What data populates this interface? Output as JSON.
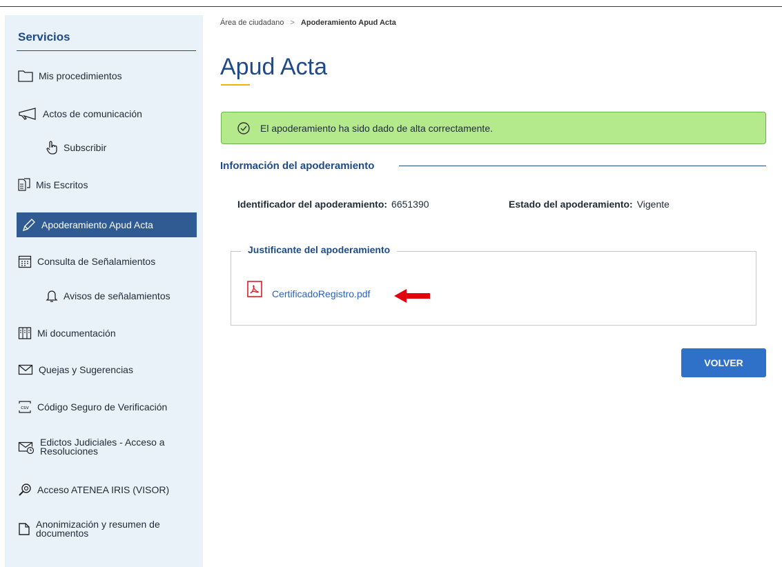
{
  "sidebar": {
    "title": "Servicios",
    "items": [
      {
        "label": "Mis procedimientos",
        "icon": "folder-icon"
      },
      {
        "label": "Actos de comunicación",
        "icon": "megaphone-icon"
      },
      {
        "label": "Subscribir",
        "icon": "hand-pointer-icon"
      },
      {
        "label": "Mis Escritos",
        "icon": "document-icon"
      },
      {
        "label": "Apoderamiento Apud Acta",
        "icon": "pen-icon",
        "active": true
      },
      {
        "label": "Consulta de Señalamientos",
        "icon": "calendar-icon"
      },
      {
        "label": "Avisos de señalamientos",
        "icon": "bell-icon"
      },
      {
        "label": "Mi documentación",
        "icon": "documentation-icon"
      },
      {
        "label": "Quejas y Sugerencias",
        "icon": "envelope-icon"
      },
      {
        "label": "Código Seguro de Verificación",
        "icon": "csv-icon"
      },
      {
        "label": "Edictos Judiciales - Acceso a Resoluciones",
        "icon": "envelope-clock-icon"
      },
      {
        "label": "Acceso ATENEA IRIS (VISOR)",
        "icon": "magnifier-icon"
      },
      {
        "label": "Anonimización y resumen de documentos",
        "icon": "file-icon"
      }
    ]
  },
  "breadcrumb": {
    "parent": "Área de ciudadano",
    "separator": ">",
    "current": "Apoderamiento Apud Acta"
  },
  "page_title": "Apud Acta",
  "alert": {
    "message": "El apoderamiento ha sido dado de alta correctamente.",
    "icon": "check-circle-icon",
    "color": "#b5ea8c"
  },
  "info": {
    "section_title": "Información del apoderamiento",
    "id_label": "Identificador del apoderamiento:",
    "id_value": "6651390",
    "status_label": "Estado del apoderamiento:",
    "status_value": "Vigente"
  },
  "justificante": {
    "legend": "Justificante del apoderamiento",
    "file_name": "CertificadoRegistro.pdf",
    "file_icon": "pdf-icon",
    "annotation": "red-arrow-icon"
  },
  "actions": {
    "back_label": "VOLVER"
  },
  "colors": {
    "primary": "#1f4a86",
    "active_bg": "#2f5b92",
    "button": "#2f71c9",
    "sidebar_bg": "#eaf2f9",
    "link": "#2a62b8"
  }
}
